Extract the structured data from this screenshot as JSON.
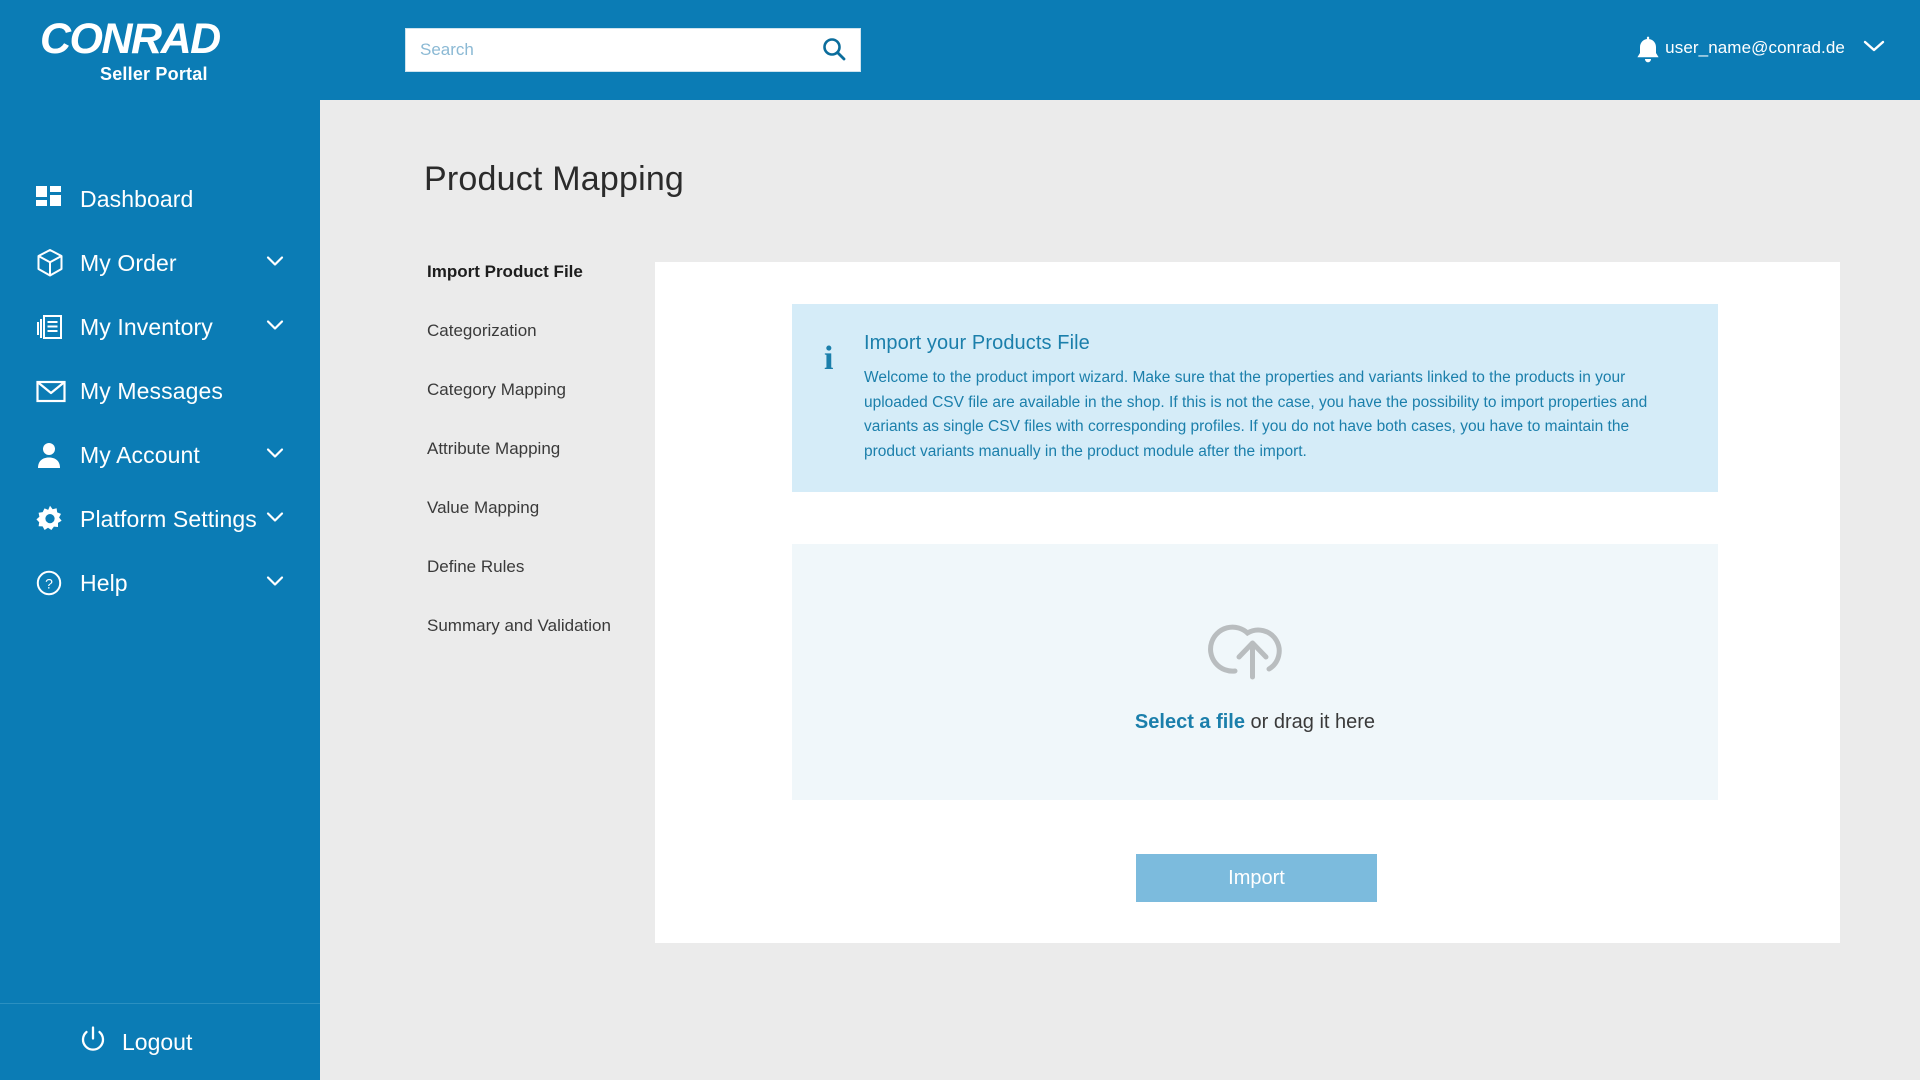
{
  "brand": {
    "logo_word": "CONRAD",
    "logo_sub": "Seller Portal",
    "accent_blue": "#0b7cb5",
    "info_blue": "#1b7fab",
    "info_bg": "#d5ecf8",
    "dropzone_bg": "#f0f7fa",
    "disabled_button": "#7cbbdd"
  },
  "header": {
    "search": {
      "placeholder": "Search",
      "value": "",
      "button_label": "search-icon"
    },
    "notifications_icon": "bell-icon",
    "user_email": "user_name@conrad.de",
    "user_caret": "chevron-down-icon"
  },
  "sidebar": {
    "items": [
      {
        "label": "Dashboard",
        "icon": "dashboard-icon",
        "expandable": false
      },
      {
        "label": "My Order",
        "icon": "package-icon",
        "expandable": true
      },
      {
        "label": "My Inventory",
        "icon": "inventory-icon",
        "expandable": true
      },
      {
        "label": "My Messages",
        "icon": "envelope-icon",
        "expandable": false
      },
      {
        "label": "My Account",
        "icon": "user-icon",
        "expandable": true
      },
      {
        "label": "Platform Settings",
        "icon": "gear-icon",
        "expandable": true
      },
      {
        "label": "Help",
        "icon": "help-circle-icon",
        "expandable": true
      }
    ],
    "logout": {
      "label": "Logout",
      "icon": "power-icon"
    }
  },
  "main": {
    "page_title": "Product Mapping",
    "steps": [
      {
        "label": "Import Product File",
        "active": true
      },
      {
        "label": "Categorization",
        "active": false
      },
      {
        "label": "Category Mapping",
        "active": false
      },
      {
        "label": "Attribute Mapping",
        "active": false
      },
      {
        "label": "Value Mapping",
        "active": false
      },
      {
        "label": "Define Rules",
        "active": false
      },
      {
        "label": "Summary and Validation",
        "active": false
      }
    ],
    "info": {
      "icon": "info-icon",
      "title": "Import your Products File",
      "body": "Welcome to the product import wizard. Make sure that the properties and variants linked to the products in your uploaded CSV file are available in the shop. If this is not the case, you have the possibility to import properties and variants as single CSV files with corresponding profiles. If you do not have both cases, you have to maintain the product variants manually in the product module after the import."
    },
    "dropzone": {
      "icon": "cloud-upload-icon",
      "link_text": "Select a file",
      "rest_text": " or drag it here"
    },
    "import_button": {
      "label": "Import",
      "disabled": true
    }
  }
}
